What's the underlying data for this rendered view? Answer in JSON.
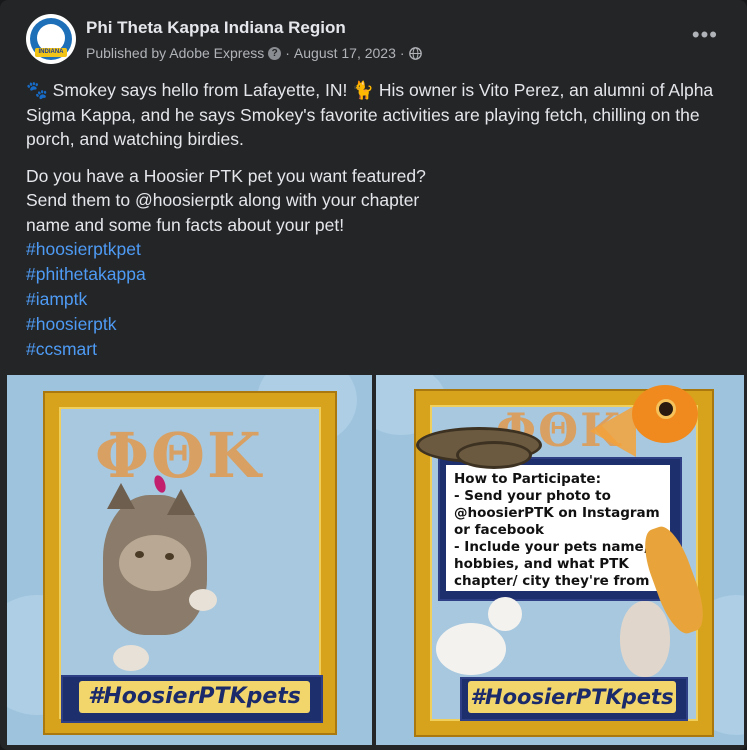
{
  "post": {
    "page_name": "Phi Theta Kappa Indiana Region",
    "published_by": "Published by Adobe Express",
    "date": "August 17, 2023",
    "separator": "·",
    "help_icon_glyph": "?",
    "more_label": "•••",
    "avatar": {
      "icon": "ptk-indiana-logo",
      "text": "INDIANA"
    },
    "body": {
      "line1": "🐾 Smokey says hello from Lafayette, IN! 🐈 His owner is Vito Perez, an alumni of Alpha Sigma Kappa, and he says Smokey's favorite activities are playing fetch, chilling on the porch, and watching birdies.",
      "line2a": "Do you have a Hoosier PTK pet you want featured?",
      "line2b": "Send them to @hoosierptk along with your chapter",
      "line2c": "name and some fun facts about your pet!"
    },
    "hashtags": [
      "#hoosierptkpet",
      "#phithetakappa",
      "#iamptk",
      "#hoosierptk",
      "#ccsmart"
    ]
  },
  "images": {
    "left": {
      "logo": "ΦΘΚ",
      "banner": "#HoosierPTKpets"
    },
    "right": {
      "logo": "ΦΘΚ",
      "banner": "#HoosierPTKpets",
      "howto": [
        "How to Participate:",
        "- Send your photo to",
        "@hoosierPTK on Instagram",
        "or facebook",
        "- Include your pets name,",
        "hobbies, and what PTK",
        "chapter/ city they're from"
      ]
    }
  },
  "colors": {
    "card": "#242526",
    "text": "#e4e6eb",
    "muted": "#b0b3b8",
    "link": "#4e9bf5",
    "gold": "#d8a31c",
    "navy": "#1e2f6e"
  }
}
